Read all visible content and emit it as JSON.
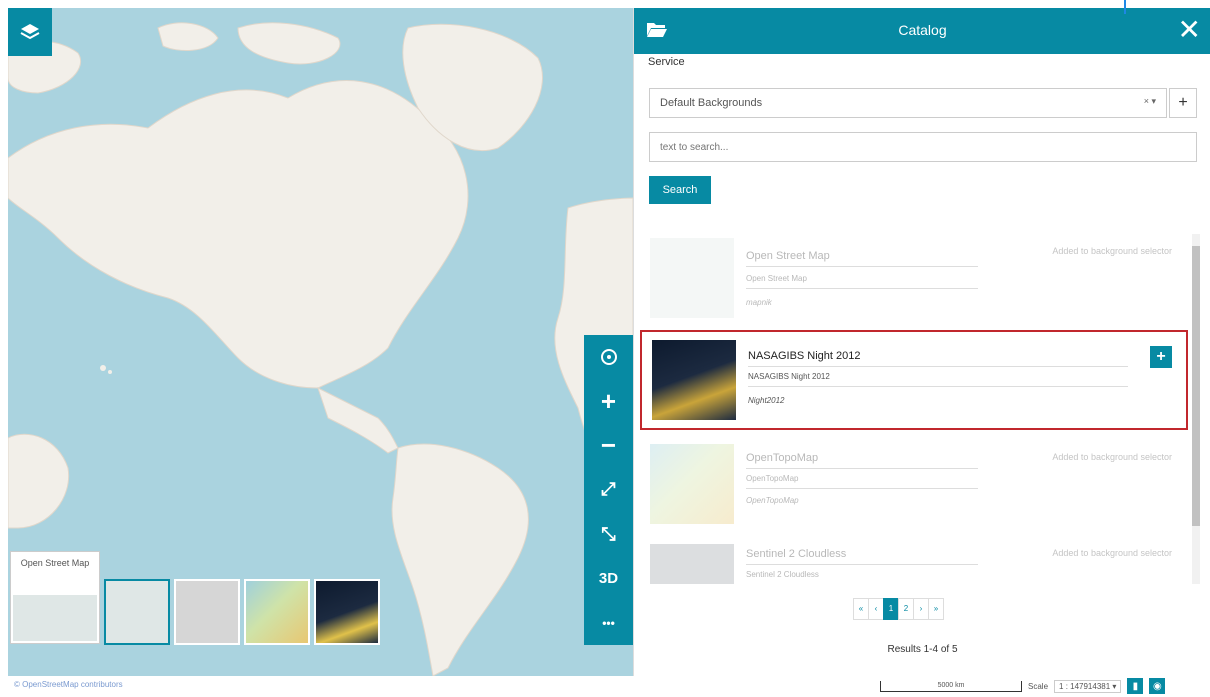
{
  "map": {
    "layers_icon": "layers-icon",
    "attribution": "© OpenStreetMap contributors",
    "background_selector": {
      "current_label": "Open Street Map",
      "thumbs": [
        "osm",
        "blank",
        "opentopomap",
        "nasa-night"
      ]
    },
    "toolbar": {
      "items": [
        {
          "name": "locate-icon",
          "glyph": "⌖"
        },
        {
          "name": "zoom-in-icon",
          "glyph": "+"
        },
        {
          "name": "zoom-out-icon",
          "glyph": "−"
        },
        {
          "name": "zoom-to-extent-icon",
          "glyph": "⤢"
        },
        {
          "name": "fullscreen-icon",
          "glyph": "⤡"
        },
        {
          "name": "3d-toggle",
          "glyph": "3D"
        },
        {
          "name": "more-icon",
          "glyph": "•••"
        }
      ]
    },
    "footer": {
      "scalebar_label": "5000 km",
      "scale_label": "Scale",
      "scale_value": "1 : 147914381 ▾"
    }
  },
  "catalog": {
    "title": "Catalog",
    "service_label": "Service",
    "service_value": "Default Backgrounds",
    "search_placeholder": "text to search...",
    "search_button": "Search",
    "records": [
      {
        "title": "Open Street Map",
        "description": "Open Street Map",
        "name": "mapnik",
        "status": "Added to background selector",
        "state": "added"
      },
      {
        "title": "NASAGIBS Night 2012",
        "description": "NASAGIBS Night 2012",
        "name": "Night2012",
        "status": "",
        "state": "available"
      },
      {
        "title": "OpenTopoMap",
        "description": "OpenTopoMap",
        "name": "OpenTopoMap",
        "status": "Added to background selector",
        "state": "added"
      },
      {
        "title": "Sentinel 2 Cloudless",
        "description": "Sentinel 2 Cloudless",
        "name": "",
        "status": "Added to background selector",
        "state": "added"
      }
    ],
    "pagination": [
      "«",
      "‹",
      "1",
      "2",
      "›",
      "»"
    ],
    "active_page": "1",
    "results_text": "Results 1-4 of 5"
  },
  "colors": {
    "accent": "#078aa3",
    "highlight": "#c1272d",
    "ocean": "#aad3df",
    "land": "#f2efe9"
  }
}
